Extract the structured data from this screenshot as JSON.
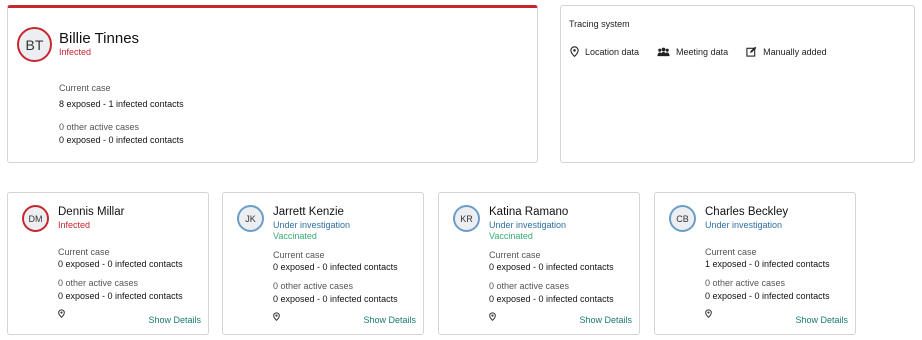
{
  "main": {
    "initials": "BT",
    "name": "Billie Tinnes",
    "status": "Infected",
    "current_case_label": "Current case",
    "current_case_value": "8 exposed - 1 infected contacts",
    "other_cases_label": "0 other active cases",
    "other_cases_value": "0 exposed - 0 infected contacts"
  },
  "tracing": {
    "title": "Tracing system",
    "items": [
      {
        "label": "Location data",
        "icon": "location-pin-icon"
      },
      {
        "label": "Meeting data",
        "icon": "group-icon"
      },
      {
        "label": "Manually added",
        "icon": "edit-icon"
      }
    ]
  },
  "contacts": [
    {
      "initials": "DM",
      "name": "Dennis Millar",
      "status": "Infected",
      "status_type": "infected",
      "vaccinated": "",
      "current_case_label": "Current case",
      "current_case_value": "0 exposed - 0 infected contacts",
      "other_cases_label": "0 other active cases",
      "other_cases_value": "0 exposed - 0 infected contacts",
      "show_details": "Show Details"
    },
    {
      "initials": "JK",
      "name": "Jarrett Kenzie",
      "status": "Under investigation",
      "status_type": "investigation",
      "vaccinated": "Vaccinated",
      "current_case_label": "Current case",
      "current_case_value": "0 exposed - 0 infected contacts",
      "other_cases_label": "0 other active cases",
      "other_cases_value": "0 exposed - 0 infected contacts",
      "show_details": "Show Details"
    },
    {
      "initials": "KR",
      "name": "Katina Ramano",
      "status": "Under investigation",
      "status_type": "investigation",
      "vaccinated": "Vaccinated",
      "current_case_label": "Current case",
      "current_case_value": "0 exposed - 0 infected contacts",
      "other_cases_label": "0 other active cases",
      "other_cases_value": "0 exposed - 0 infected contacts",
      "show_details": "Show Details"
    },
    {
      "initials": "CB",
      "name": "Charles Beckley",
      "status": "Under investigation",
      "status_type": "investigation",
      "vaccinated": "",
      "current_case_label": "Current case",
      "current_case_value": "1 exposed - 0 infected contacts",
      "other_cases_label": "0 other active cases",
      "other_cases_value": "0 exposed - 0 infected contacts",
      "show_details": "Show Details"
    }
  ],
  "colors": {
    "infected": "#c8262e",
    "investigation": "#2f6ea5",
    "vaccinated": "#3aaa75",
    "link": "#1b7a72"
  }
}
